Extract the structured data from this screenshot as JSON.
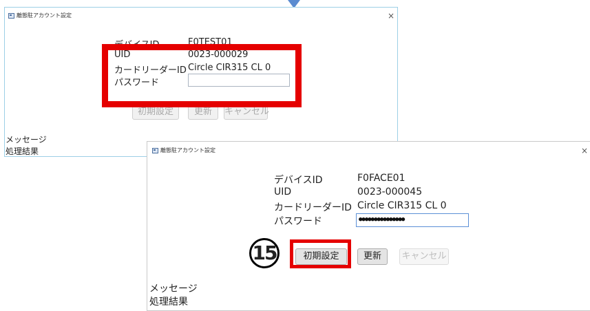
{
  "window1": {
    "title": "離態駐アカウント設定",
    "close": "×",
    "fields": {
      "device_id_label": "デバイスID",
      "device_id_value": "F0TEST01",
      "uid_label": "UID",
      "uid_value": "0023-000029",
      "reader_label": "カードリーダーID",
      "reader_value": "Circle CIR315 CL 0",
      "password_label": "パスワード",
      "password_value": ""
    },
    "buttons": {
      "init": "初期設定",
      "update": "更新",
      "cancel": "キャンセル"
    },
    "message_label": "メッセージ",
    "result_label": "処理結果"
  },
  "window2": {
    "title": "離態駐アカウント設定",
    "close": "×",
    "fields": {
      "device_id_label": "デバイスID",
      "device_id_value": "F0FACE01",
      "uid_label": "UID",
      "uid_value": "0023-000045",
      "reader_label": "カードリーダーID",
      "reader_value": "Circle CIR315 CL 0",
      "password_label": "パスワード",
      "password_value": "●●●●●●●●●●●●●●●"
    },
    "buttons": {
      "init": "初期設定",
      "update": "更新",
      "cancel": "キャンセル"
    },
    "message_label": "メッセージ",
    "result_label": "処理結果"
  },
  "step_marker": "15",
  "colors": {
    "highlight": "#e50000",
    "window_border": "#9ccfe6",
    "arrow": "#5a8bd0"
  }
}
